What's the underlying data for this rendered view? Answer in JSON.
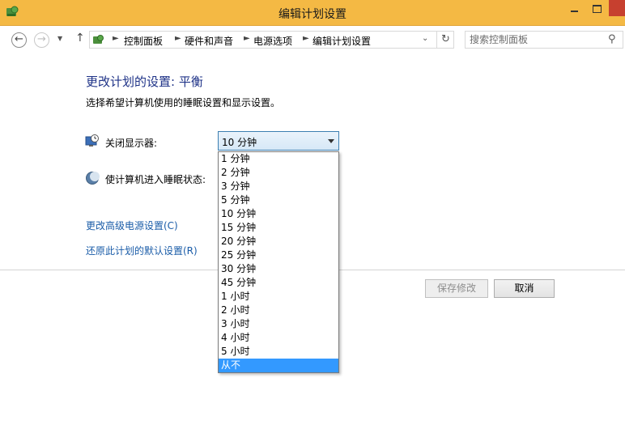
{
  "window": {
    "title": "编辑计划设置"
  },
  "nav": {
    "breadcrumbs": [
      "控制面板",
      "硬件和声音",
      "电源选项",
      "编辑计划设置"
    ],
    "search_placeholder": "搜索控制面板"
  },
  "content": {
    "title": "更改计划的设置: 平衡",
    "subtitle": "选择希望计算机使用的睡眠设置和显示设置。",
    "display_off_label": "关闭显示器:",
    "sleep_label": "使计算机进入睡眠状态:",
    "display_off_value": "10 分钟",
    "dropdown_options": [
      "1 分钟",
      "2 分钟",
      "3 分钟",
      "5 分钟",
      "10 分钟",
      "15 分钟",
      "20 分钟",
      "25 分钟",
      "30 分钟",
      "45 分钟",
      "1 小时",
      "2 小时",
      "3 小时",
      "4 小时",
      "5 小时",
      "从不"
    ],
    "highlighted_option": "从不",
    "link_advanced": "更改高级电源设置(C)",
    "link_restore": "还原此计划的默认设置(R)"
  },
  "buttons": {
    "save": "保存修改",
    "cancel": "取消"
  },
  "colors": {
    "titlebar": "#f4b944",
    "title_text": "#1e3287",
    "link": "#1a5ca8",
    "highlight": "#3399ff"
  },
  "icons": {
    "app": "control-panel-icon",
    "display": "monitor-clock-icon",
    "sleep": "moon-icon",
    "search": "search-icon"
  }
}
